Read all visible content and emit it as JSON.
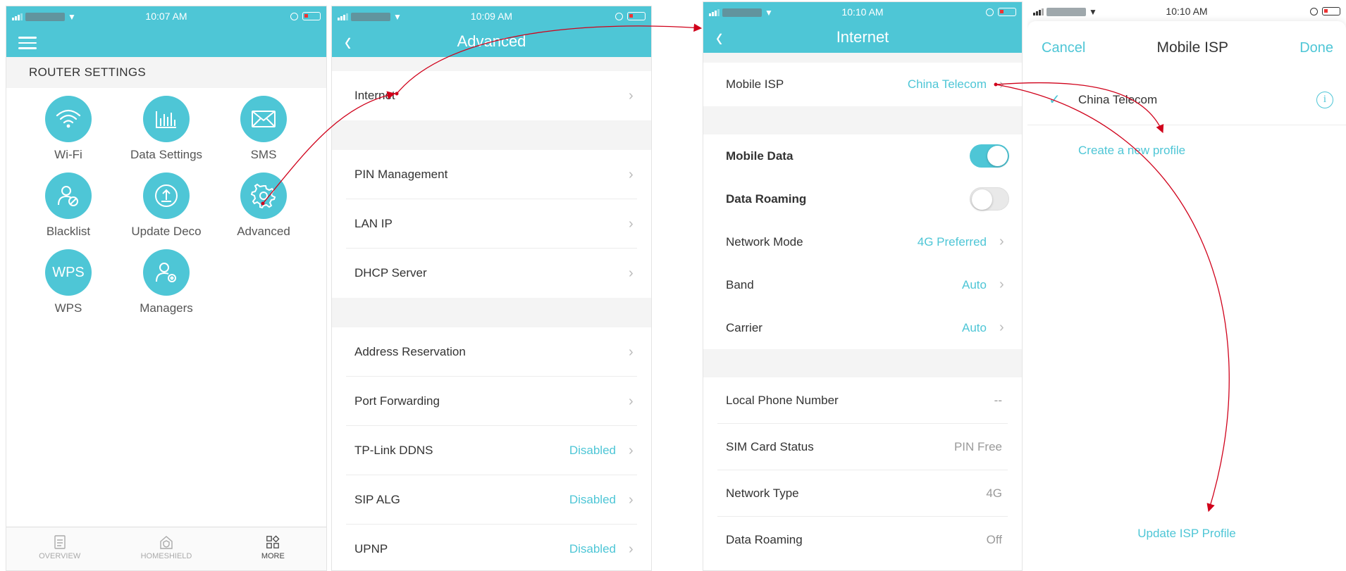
{
  "screen1": {
    "time": "10:07 AM",
    "section_title": "ROUTER SETTINGS",
    "tiles": [
      {
        "label": "Wi-Fi",
        "icon": "wifi-icon"
      },
      {
        "label": "Data Settings",
        "icon": "chart-icon"
      },
      {
        "label": "SMS",
        "icon": "envelope-icon"
      },
      {
        "label": "Blacklist",
        "icon": "blocked-user-icon"
      },
      {
        "label": "Update Deco",
        "icon": "upload-icon"
      },
      {
        "label": "Advanced",
        "icon": "gear-icon"
      },
      {
        "label": "WPS",
        "icon": "wps-text-icon",
        "glyph": "WPS"
      },
      {
        "label": "Managers",
        "icon": "user-gear-icon"
      }
    ],
    "tabs": [
      {
        "label": "OVERVIEW",
        "icon": "document-icon",
        "active": false
      },
      {
        "label": "HOMESHIELD",
        "icon": "house-shield-icon",
        "active": false
      },
      {
        "label": "MORE",
        "icon": "grid-more-icon",
        "active": true
      }
    ]
  },
  "screen2": {
    "time": "10:09 AM",
    "title": "Advanced",
    "rows": [
      {
        "label": "Internet"
      },
      {
        "label": "PIN Management"
      },
      {
        "label": "LAN IP"
      },
      {
        "label": "DHCP Server"
      },
      {
        "label": "Address Reservation"
      },
      {
        "label": "Port Forwarding"
      },
      {
        "label": "TP-Link DDNS",
        "value": "Disabled"
      },
      {
        "label": "SIP ALG",
        "value": "Disabled"
      },
      {
        "label": "UPNP",
        "value": "Disabled"
      }
    ]
  },
  "screen3": {
    "time": "10:10 AM",
    "title": "Internet",
    "mobile_isp": {
      "label": "Mobile ISP",
      "value": "China Telecom"
    },
    "mobile_data": {
      "label": "Mobile Data",
      "on": true
    },
    "data_roaming_toggle": {
      "label": "Data Roaming",
      "on": false
    },
    "network_mode": {
      "label": "Network Mode",
      "value": "4G Preferred"
    },
    "band": {
      "label": "Band",
      "value": "Auto"
    },
    "carrier": {
      "label": "Carrier",
      "value": "Auto"
    },
    "info_rows": [
      {
        "label": "Local Phone Number",
        "value": "--"
      },
      {
        "label": "SIM Card Status",
        "value": "PIN Free"
      },
      {
        "label": "Network Type",
        "value": "4G"
      },
      {
        "label": "Data Roaming",
        "value": "Off"
      }
    ]
  },
  "screen4": {
    "time": "10:10 AM",
    "cancel": "Cancel",
    "title": "Mobile ISP",
    "done": "Done",
    "selected_isp": "China Telecom",
    "create_profile": "Create a new profile",
    "update_profile": "Update ISP Profile"
  },
  "colors": {
    "accent": "#4ec6d6",
    "arrow": "#d0021b"
  }
}
